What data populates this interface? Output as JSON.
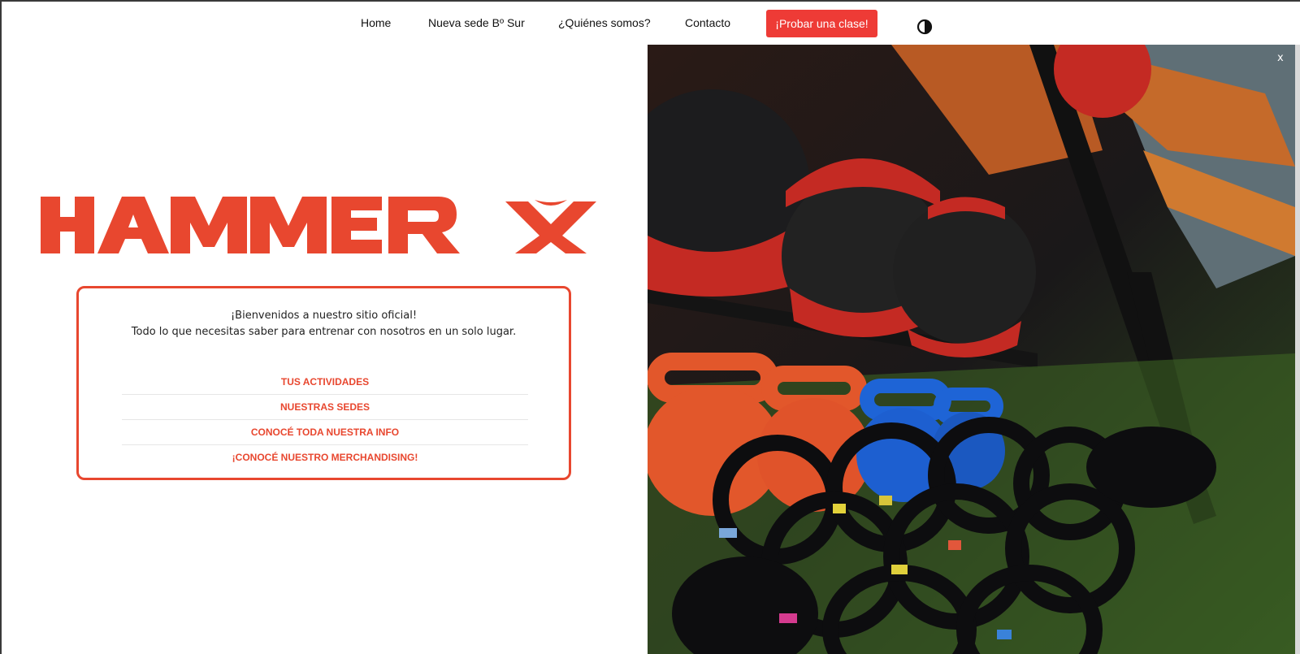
{
  "nav": {
    "home": "Home",
    "sede": "Nueva sede Bº Sur",
    "quienes": "¿Quiénes somos?",
    "contacto": "Contacto",
    "cta": "¡Probar una clase!",
    "contrast_icon": "contrast-icon"
  },
  "logo": {
    "text": "HAMMER X",
    "color": "#e8472f"
  },
  "card": {
    "welcome_line1": "¡Bienvenidos a nuestro sitio oficial!",
    "welcome_line2": "Todo lo que necesitas saber para entrenar con nosotros en un solo lugar.",
    "links": [
      "TUS ACTIVIDADES",
      "NUESTRAS SEDES",
      "CONOCÉ TODA NUESTRA INFO",
      "¡CONOCÉ NUESTRO MERCHANDISING!"
    ]
  },
  "photo": {
    "close_label": "x"
  },
  "colors": {
    "accent": "#e8472f",
    "cta": "#ee3b36"
  }
}
